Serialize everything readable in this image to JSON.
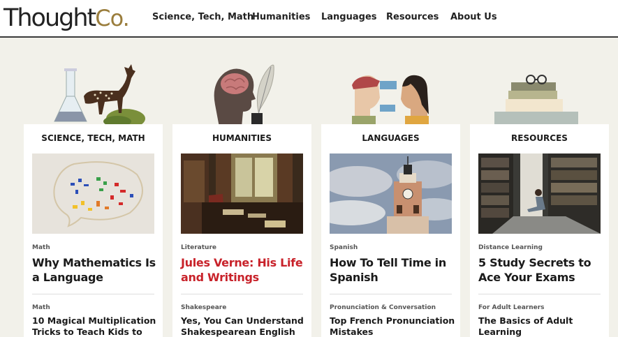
{
  "logo": {
    "main": "Thought",
    "suffix": "Co."
  },
  "nav": [
    "Science, Tech, Math",
    "Humanities",
    "Languages",
    "Resources",
    "About Us"
  ],
  "cards": [
    {
      "title": "SCIENCE, TECH, MATH",
      "illustration": "flask-and-deer",
      "image": "math-symbols-speech-bubble",
      "article1": {
        "category": "Math",
        "headline": "Why Mathematics Is a Language"
      },
      "article2": {
        "category": "Math",
        "headline": "10 Magical Multiplication Tricks to Teach Kids to"
      }
    },
    {
      "title": "HUMANITIES",
      "illustration": "head-with-brain-and-quill",
      "image": "writer-study-room",
      "article1": {
        "category": "Literature",
        "headline": "Jules Verne: His Life and Writings"
      },
      "article2": {
        "category": "Shakespeare",
        "headline": "Yes, You Can Understand Shakespearean English"
      }
    },
    {
      "title": "LANGUAGES",
      "illustration": "two-people-speech-bubbles",
      "image": "clock-tower-building",
      "article1": {
        "category": "Spanish",
        "headline": "How To Tell Time in Spanish"
      },
      "article2": {
        "category": "Pronunciation & Conversation",
        "headline": "Top French Pronunciation Mistakes"
      }
    },
    {
      "title": "RESOURCES",
      "illustration": "stacked-books-and-glasses",
      "image": "student-reading-in-library",
      "article1": {
        "category": "Distance Learning",
        "headline": "5 Study Secrets to Ace Your Exams"
      },
      "article2": {
        "category": "For Adult Learners",
        "headline": "The Basics of Adult Learning"
      }
    }
  ],
  "colors": {
    "accent_red": "#c8222a",
    "logo_gold": "#9a7d3c",
    "page_bg": "#f2f1ea"
  }
}
